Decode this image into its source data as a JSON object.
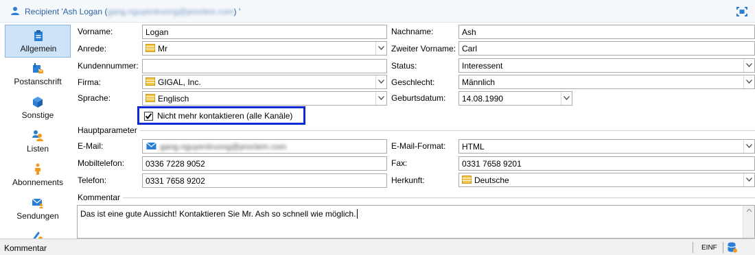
{
  "window": {
    "title_prefix": "Recipient 'Ash Logan (",
    "title_email": "gang.nguyentruong@proclem.com",
    "title_suffix": ") '",
    "maximize_icon": "maximize-icon",
    "user_icon": "user-icon"
  },
  "sidebar": {
    "items": [
      {
        "label": "Allgemein",
        "icon": "clipboard-icon",
        "active": true
      },
      {
        "label": "Postanschrift",
        "icon": "mailbox-icon",
        "active": false
      },
      {
        "label": "Sonstige",
        "icon": "cube-icon",
        "active": false
      },
      {
        "label": "Listen",
        "icon": "people-icon",
        "active": false
      },
      {
        "label": "Abonnements",
        "icon": "person-icon",
        "active": false
      },
      {
        "label": "Sendungen",
        "icon": "envelope-user-icon",
        "active": false
      },
      {
        "label": "",
        "icon": "link-icon",
        "active": false
      }
    ]
  },
  "form": {
    "vorname": {
      "label": "Vorname:",
      "value": "Logan"
    },
    "nachname": {
      "label": "Nachname:",
      "value": "Ash"
    },
    "anrede": {
      "label": "Anrede:",
      "value": "Mr"
    },
    "zweiter_vorname": {
      "label": "Zweiter Vorname:",
      "value": "Carl"
    },
    "kundennummer": {
      "label": "Kundennummer:",
      "value": ""
    },
    "status": {
      "label": "Status:",
      "value": "Interessent"
    },
    "firma": {
      "label": "Firma:",
      "value": "GIGAL, Inc."
    },
    "geschlecht": {
      "label": "Geschlecht:",
      "value": "Männlich"
    },
    "sprache": {
      "label": "Sprache:",
      "value": "Englisch"
    },
    "geburtsdatum": {
      "label": "Geburtsdatum:",
      "value": "14.08.1990"
    },
    "nicht_kontaktieren": {
      "label": "Nicht mehr kontaktieren (alle Kanäle)",
      "checked": true
    },
    "hauptparameter": {
      "label": "Hauptparameter"
    },
    "email": {
      "label": "E-Mail:",
      "value": "gang.nguyentruong@proclem.com"
    },
    "email_format": {
      "label": "E-Mail-Format:",
      "value": "HTML"
    },
    "mobiltelefon": {
      "label": "Mobiltelefon:",
      "value": "0336 7228 9052"
    },
    "fax": {
      "label": "Fax:",
      "value": "0331 7658 9201"
    },
    "telefon": {
      "label": "Telefon:",
      "value": "0331 7658 9202"
    },
    "herkunft": {
      "label": "Herkunft:",
      "value": "Deutsche"
    },
    "kommentar": {
      "label": "Kommentar",
      "value": "Das ist eine gute Aussicht! Kontaktieren Sie Mr. Ash so schnell wie möglich."
    }
  },
  "statusbar": {
    "left_text": "Kommentar",
    "mode": "EINF",
    "db_icon": "database-icon"
  },
  "colors": {
    "accent": "#2b5fa0",
    "highlight_border": "#0b2ad6",
    "active_tab_bg": "#cde3f8",
    "link_icon_yellow": "#f2c443",
    "icon_blue": "#2a7fd4",
    "icon_orange": "#f39a1c"
  }
}
